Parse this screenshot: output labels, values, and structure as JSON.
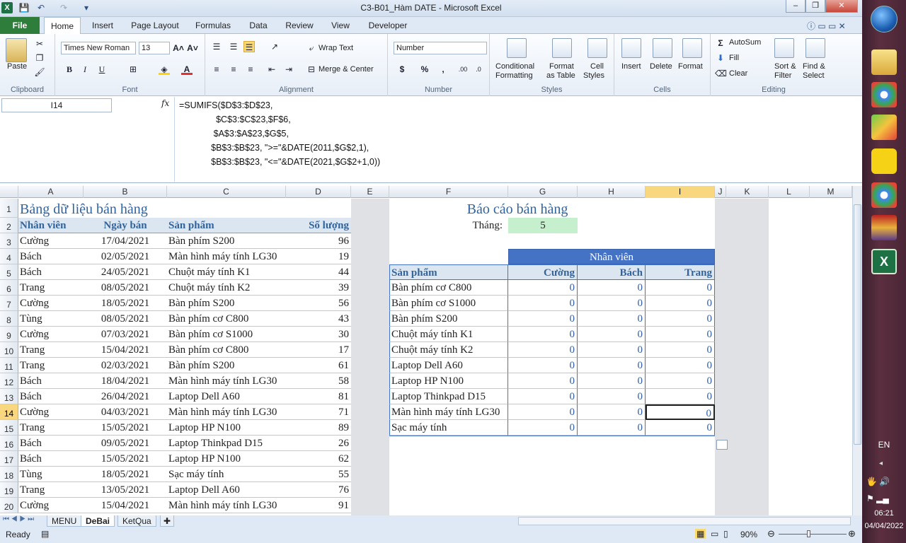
{
  "title_bar": {
    "title": "C3-B01_Hàm DATE  -  Microsoft Excel",
    "minimize": "–",
    "restore": "❐",
    "close": "✕"
  },
  "quick_access": {
    "save": "💾",
    "undo": "↶",
    "redo": "↷",
    "customize": "▾"
  },
  "ribbon_tabs": [
    "File",
    "Home",
    "Insert",
    "Page Layout",
    "Formulas",
    "Data",
    "Review",
    "View",
    "Developer"
  ],
  "active_tab": "Home",
  "ribbon": {
    "clipboard": {
      "paste": "Paste",
      "label": "Clipboard"
    },
    "font": {
      "name": "Times New Roman",
      "size": "13",
      "bold": "B",
      "italic": "I",
      "underline": "U",
      "label": "Font"
    },
    "alignment": {
      "wrap": "Wrap Text",
      "merge": "Merge & Center",
      "label": "Alignment"
    },
    "number": {
      "format": "Number",
      "currency": "$",
      "percent": "%",
      "comma": ",",
      "label": "Number"
    },
    "styles": {
      "cond": "Conditional",
      "cond2": "Formatting",
      "fmt": "Format",
      "fmt2": "as Table",
      "cell": "Cell",
      "cell2": "Styles",
      "label": "Styles"
    },
    "cells": {
      "insert": "Insert",
      "delete": "Delete",
      "format": "Format",
      "label": "Cells"
    },
    "editing": {
      "autosum": "AutoSum",
      "fill": "Fill",
      "clear": "Clear",
      "sort": "Sort &",
      "sort2": "Filter",
      "find": "Find &",
      "find2": "Select",
      "label": "Editing"
    }
  },
  "formula_bar": {
    "name_box": "I14",
    "fx": "fx",
    "lines": [
      "=SUMIFS($D$3:$D$23,",
      "               $C$3:$C$23,$F$6,",
      "              $A$3:$A$23,$G$5,",
      "             $B$3:$B$23, \">=\"&DATE(2011,$G$2,1),",
      "             $B$3:$B$23, \"<=\"&DATE(2021,$G$2+1,0))"
    ]
  },
  "columns": [
    "A",
    "B",
    "C",
    "D",
    "E",
    "F",
    "G",
    "H",
    "I",
    "J",
    "K",
    "L",
    "M"
  ],
  "rows": [
    "1",
    "2",
    "3",
    "4",
    "5",
    "6",
    "7",
    "8",
    "9",
    "10",
    "11",
    "12",
    "13",
    "14",
    "15",
    "16",
    "17",
    "18",
    "19",
    "20"
  ],
  "data_table": {
    "title": "Bảng dữ liệu bán hàng",
    "headers": [
      "Nhân viên",
      "Ngày bán",
      "Sản phẩm",
      "Số lượng"
    ],
    "rows": [
      [
        "Cường",
        "17/04/2021",
        "Bàn phím S200",
        "96"
      ],
      [
        "Bách",
        "02/05/2021",
        "Màn hình máy tính LG30",
        "19"
      ],
      [
        "Bách",
        "24/05/2021",
        "Chuột máy tính K1",
        "44"
      ],
      [
        "Trang",
        "08/05/2021",
        "Chuột máy tính K2",
        "39"
      ],
      [
        "Cường",
        "18/05/2021",
        "Bàn phím S200",
        "56"
      ],
      [
        "Tùng",
        "08/05/2021",
        "Bàn phím cơ C800",
        "43"
      ],
      [
        "Cường",
        "07/03/2021",
        "Bàn phím cơ S1000",
        "30"
      ],
      [
        "Trang",
        "15/04/2021",
        "Bàn phím cơ C800",
        "17"
      ],
      [
        "Trang",
        "02/03/2021",
        "Bàn phím S200",
        "61"
      ],
      [
        "Bách",
        "18/04/2021",
        "Màn hình máy tính LG30",
        "58"
      ],
      [
        "Bách",
        "26/04/2021",
        "Laptop Dell A60",
        "81"
      ],
      [
        "Cường",
        "04/03/2021",
        "Màn hình máy tính LG30",
        "71"
      ],
      [
        "Trang",
        "15/05/2021",
        "Laptop HP N100",
        "89"
      ],
      [
        "Bách",
        "09/05/2021",
        "Laptop Thinkpad D15",
        "26"
      ],
      [
        "Bách",
        "15/05/2021",
        "Laptop HP N100",
        "62"
      ],
      [
        "Tùng",
        "18/05/2021",
        "Sạc máy tính",
        "55"
      ],
      [
        "Trang",
        "13/05/2021",
        "Laptop Dell A60",
        "76"
      ],
      [
        "Cường",
        "15/04/2021",
        "Màn hình máy tính LG30",
        "91"
      ]
    ]
  },
  "report": {
    "title": "Báo cáo bán hàng",
    "month_label": "Tháng:",
    "month_value": "5",
    "group_header": "Nhân viên",
    "product_header": "Sản phẩm",
    "employees": [
      "Cường",
      "Bách",
      "Trang"
    ],
    "products": [
      "Bàn phím cơ C800",
      "Bàn phím cơ S1000",
      "Bàn phím S200",
      "Chuột máy tính K1",
      "Chuột máy tính K2",
      "Laptop Dell A60",
      "Laptop HP N100",
      "Laptop Thinkpad D15",
      "Màn hình máy tính LG30",
      "Sạc máy tính"
    ],
    "value": "0"
  },
  "sheets": [
    "MENU",
    "DeBai",
    "KetQua"
  ],
  "active_sheet": "DeBai",
  "status": {
    "ready": "Ready",
    "zoom": "90%"
  },
  "taskbar": {
    "lang": "EN",
    "time": "06:21",
    "date": "04/04/2022"
  },
  "colors": {
    "header_blue": "#4472c4",
    "header_light": "#dce6f1",
    "month_green": "#c6efce",
    "accent_green": "#2f7d3b"
  }
}
